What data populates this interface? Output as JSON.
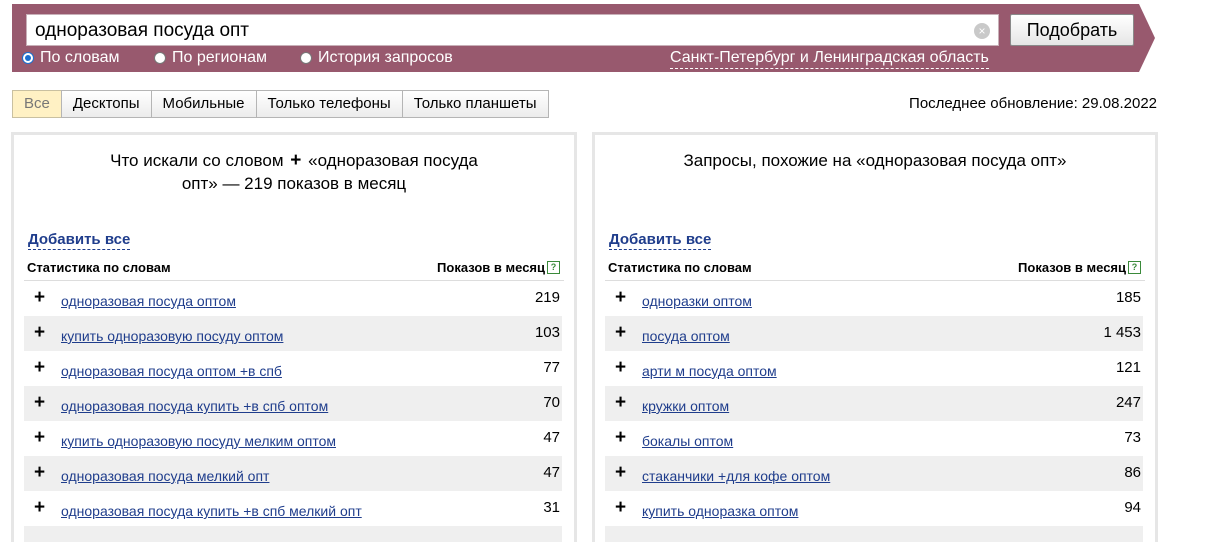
{
  "search": {
    "query": "одноразовая посуда опт",
    "submit_label": "Подобрать",
    "modes": [
      "По словам",
      "По регионам",
      "История запросов"
    ],
    "region": "Санкт-Петербург и Ленинградская область"
  },
  "device_tabs": [
    "Все",
    "Десктопы",
    "Мобильные",
    "Только телефоны",
    "Только планшеты"
  ],
  "last_update": "Последнее обновление: 29.08.2022",
  "left_panel": {
    "title_pre": "Что искали со словом",
    "title_plus": "+",
    "title_line1_post": "«одноразовая посуда",
    "title_line2": "опт» — 219 показов в месяц",
    "add_all": "Добавить все",
    "col_words": "Статистика по словам",
    "col_shows": "Показов в месяц",
    "rows": [
      {
        "phrase": "одноразовая посуда оптом",
        "count": "219"
      },
      {
        "phrase": "купить одноразовую посуду оптом",
        "count": "103"
      },
      {
        "phrase": "одноразовая посуда оптом +в спб",
        "count": "77"
      },
      {
        "phrase": "одноразовая посуда купить +в спб оптом",
        "count": "70"
      },
      {
        "phrase": "купить одноразовую посуду мелким оптом",
        "count": "47"
      },
      {
        "phrase": "одноразовая посуда мелкий опт",
        "count": "47"
      },
      {
        "phrase": "одноразовая посуда купить +в спб мелкий опт",
        "count": "31"
      }
    ]
  },
  "right_panel": {
    "title": "Запросы, похожие на «одноразовая посуда опт»",
    "add_all": "Добавить все",
    "col_words": "Статистика по словам",
    "col_shows": "Показов в месяц",
    "rows": [
      {
        "phrase": "одноразки оптом",
        "count": "185"
      },
      {
        "phrase": "посуда оптом",
        "count": "1 453"
      },
      {
        "phrase": "арти м посуда оптом",
        "count": "121"
      },
      {
        "phrase": "кружки оптом",
        "count": "247"
      },
      {
        "phrase": "бокалы оптом",
        "count": "73"
      },
      {
        "phrase": "стаканчики +для кофе оптом",
        "count": "86"
      },
      {
        "phrase": "купить одноразка оптом",
        "count": "94"
      }
    ]
  },
  "row_plus": "+",
  "help_glyph": "?",
  "clear_glyph": "×",
  "colors": {
    "band": "#98596e",
    "link": "#1f3d8c",
    "active_tab": "#fff1c4",
    "stripe": "#efefef"
  },
  "icons": [
    "clear-icon",
    "help-icon",
    "plus-icon",
    "radio-icon"
  ]
}
